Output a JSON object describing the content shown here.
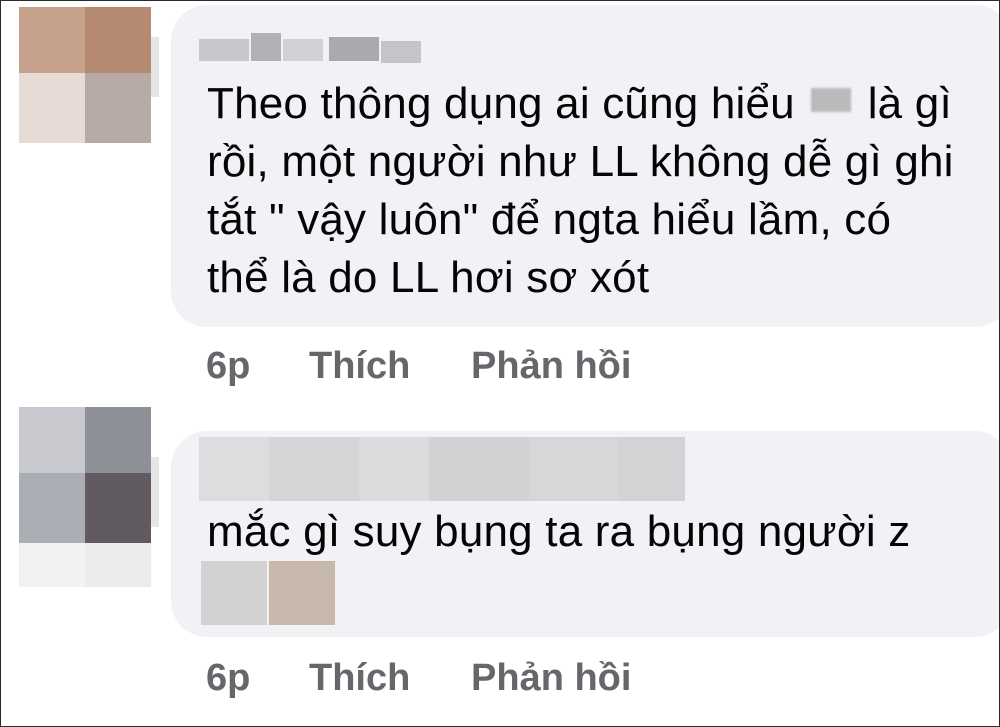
{
  "comments": [
    {
      "text_lines": [
        "Theo thông dụng ai cũng hiểu ",
        " là gì",
        "rồi, một người như LL không dễ gì ghi",
        "tắt \" vậy luôn\" để ngta hiểu lầm, có",
        "thể là do LL hơi sơ xót"
      ],
      "time": "6p",
      "like_label": "Thích",
      "reply_label": "Phản hồi"
    },
    {
      "text_lines": [
        "mắc gì suy bụng ta ra bụng người z"
      ],
      "time": "6p",
      "like_label": "Thích",
      "reply_label": "Phản hồi"
    }
  ],
  "colors": {
    "bubble": "#f0f2f5",
    "text": "#050505",
    "action": "#65676b"
  },
  "icons": [
    "avatar-blurred",
    "name-blurred",
    "censored-word",
    "attachment-blurred"
  ]
}
